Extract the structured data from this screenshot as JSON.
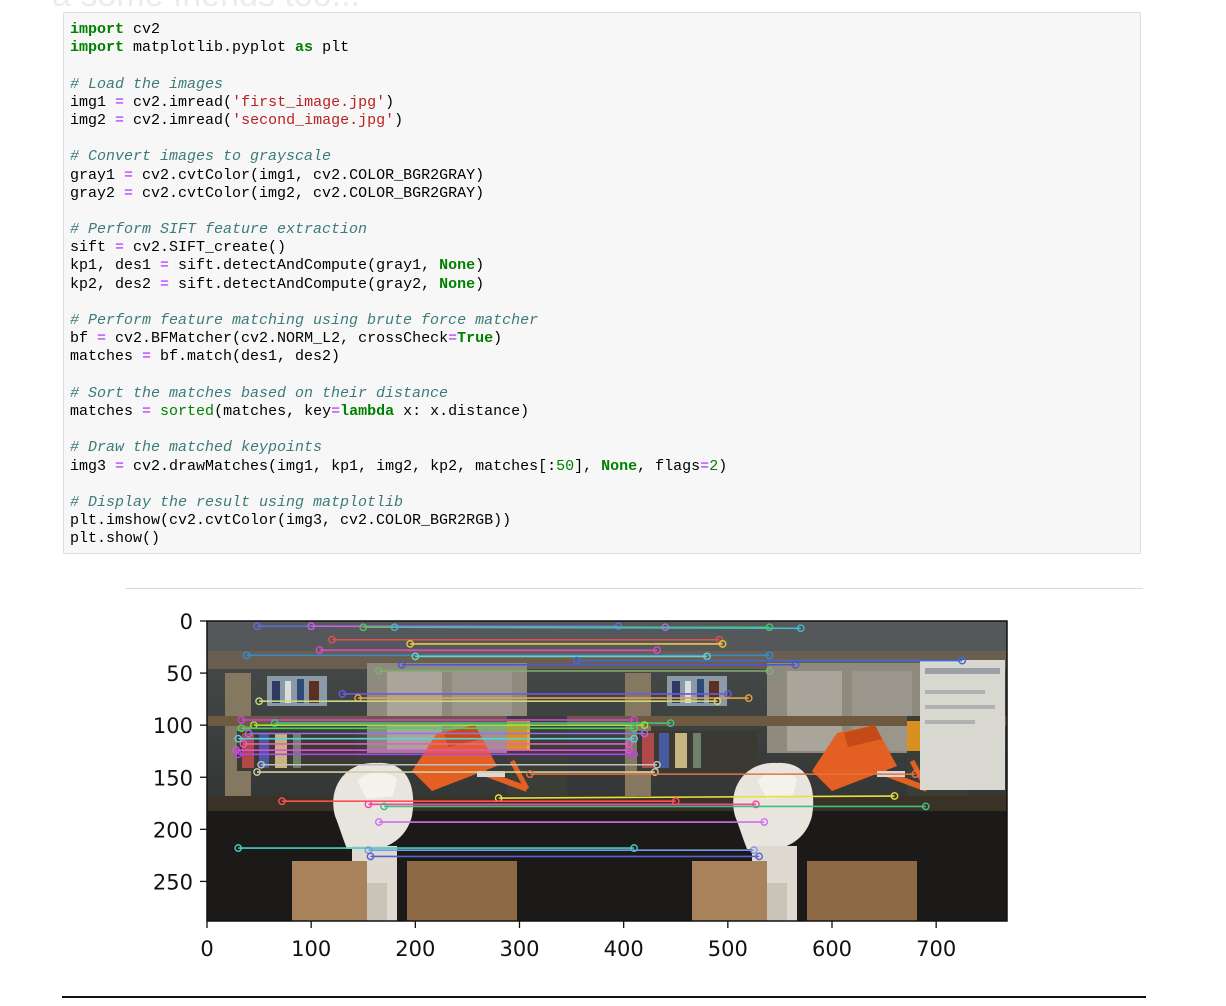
{
  "background_heading": "a some friends too...",
  "code_lines": [
    [
      [
        "kw",
        "import"
      ],
      [
        "t",
        " cv2"
      ]
    ],
    [
      [
        "kw",
        "import"
      ],
      [
        "t",
        " matplotlib.pyplot "
      ],
      [
        "kw",
        "as"
      ],
      [
        "t",
        " plt"
      ]
    ],
    [],
    [
      [
        "cm",
        "# Load the images"
      ]
    ],
    [
      [
        "t",
        "img1 "
      ],
      [
        "op",
        "="
      ],
      [
        "t",
        " cv2.imread("
      ],
      [
        "str",
        "'first_image.jpg'"
      ],
      [
        "t",
        ")"
      ]
    ],
    [
      [
        "t",
        "img2 "
      ],
      [
        "op",
        "="
      ],
      [
        "t",
        " cv2.imread("
      ],
      [
        "str",
        "'second_image.jpg'"
      ],
      [
        "t",
        ")"
      ]
    ],
    [],
    [
      [
        "cm",
        "# Convert images to grayscale"
      ]
    ],
    [
      [
        "t",
        "gray1 "
      ],
      [
        "op",
        "="
      ],
      [
        "t",
        " cv2.cvtColor(img1, cv2.COLOR_BGR2GRAY)"
      ]
    ],
    [
      [
        "t",
        "gray2 "
      ],
      [
        "op",
        "="
      ],
      [
        "t",
        " cv2.cvtColor(img2, cv2.COLOR_BGR2GRAY)"
      ]
    ],
    [],
    [
      [
        "cm",
        "# Perform SIFT feature extraction"
      ]
    ],
    [
      [
        "t",
        "sift "
      ],
      [
        "op",
        "="
      ],
      [
        "t",
        " cv2.SIFT_create()"
      ]
    ],
    [
      [
        "t",
        "kp1, des1 "
      ],
      [
        "op",
        "="
      ],
      [
        "t",
        " sift.detectAndCompute(gray1, "
      ],
      [
        "kw",
        "None"
      ],
      [
        "t",
        ")"
      ]
    ],
    [
      [
        "t",
        "kp2, des2 "
      ],
      [
        "op",
        "="
      ],
      [
        "t",
        " sift.detectAndCompute(gray2, "
      ],
      [
        "kw",
        "None"
      ],
      [
        "t",
        ")"
      ]
    ],
    [],
    [
      [
        "cm",
        "# Perform feature matching using brute force matcher"
      ]
    ],
    [
      [
        "t",
        "bf "
      ],
      [
        "op",
        "="
      ],
      [
        "t",
        " cv2.BFMatcher(cv2.NORM_L2, crossCheck"
      ],
      [
        "op",
        "="
      ],
      [
        "kw",
        "True"
      ],
      [
        "t",
        ")"
      ]
    ],
    [
      [
        "t",
        "matches "
      ],
      [
        "op",
        "="
      ],
      [
        "t",
        " bf.match(des1, des2)"
      ]
    ],
    [],
    [
      [
        "cm",
        "# Sort the matches based on their distance"
      ]
    ],
    [
      [
        "t",
        "matches "
      ],
      [
        "op",
        "="
      ],
      [
        "t",
        " "
      ],
      [
        "bi",
        "sorted"
      ],
      [
        "t",
        "(matches, key"
      ],
      [
        "op",
        "="
      ],
      [
        "kw",
        "lambda"
      ],
      [
        "t",
        " x: x.distance)"
      ]
    ],
    [],
    [
      [
        "cm",
        "# Draw the matched keypoints"
      ]
    ],
    [
      [
        "t",
        "img3 "
      ],
      [
        "op",
        "="
      ],
      [
        "t",
        " cv2.drawMatches(img1, kp1, img2, kp2, matches[:"
      ],
      [
        "num",
        "50"
      ],
      [
        "t",
        "], "
      ],
      [
        "kw",
        "None"
      ],
      [
        "t",
        ", flags"
      ],
      [
        "op",
        "="
      ],
      [
        "num",
        "2"
      ],
      [
        "t",
        ")"
      ]
    ],
    [],
    [
      [
        "cm",
        "# Display the result using matplotlib"
      ]
    ],
    [
      [
        "t",
        "plt.imshow(cv2.cvtColor(img3, cv2.COLOR_BGR2RGB))"
      ]
    ],
    [
      [
        "t",
        "plt.show()"
      ]
    ]
  ],
  "chart_data": {
    "type": "image",
    "xlim": [
      0,
      768
    ],
    "ylim": [
      288,
      0
    ],
    "xticks": [
      0,
      100,
      200,
      300,
      400,
      500,
      600,
      700
    ],
    "yticks": [
      0,
      50,
      100,
      150,
      200,
      250
    ],
    "image_width_per_view": 384,
    "matches": [
      {
        "y1": 5,
        "x1": 48,
        "y2": 5,
        "x2": 395,
        "color": "#5b6fd8"
      },
      {
        "y1": 5,
        "x1": 100,
        "y2": 6,
        "x2": 440,
        "color": "#c860e0"
      },
      {
        "y1": 6,
        "x1": 150,
        "y2": 6,
        "x2": 540,
        "color": "#52c75a"
      },
      {
        "y1": 6,
        "x1": 180,
        "y2": 7,
        "x2": 570,
        "color": "#44b8c8"
      },
      {
        "y1": 18,
        "x1": 120,
        "y2": 18,
        "x2": 492,
        "color": "#e05050"
      },
      {
        "y1": 22,
        "x1": 195,
        "y2": 22,
        "x2": 495,
        "color": "#e8c840"
      },
      {
        "y1": 28,
        "x1": 108,
        "y2": 28,
        "x2": 432,
        "color": "#d84ac0"
      },
      {
        "y1": 33,
        "x1": 38,
        "y2": 33,
        "x2": 540,
        "color": "#2f8fd0"
      },
      {
        "y1": 34,
        "x1": 200,
        "y2": 34,
        "x2": 480,
        "color": "#70d0c0"
      },
      {
        "y1": 38,
        "x1": 355,
        "y2": 38,
        "x2": 725,
        "color": "#3c6be0"
      },
      {
        "y1": 42,
        "x1": 187,
        "y2": 42,
        "x2": 565,
        "color": "#4a58c8"
      },
      {
        "y1": 48,
        "x1": 165,
        "y2": 48,
        "x2": 540,
        "color": "#7fb070"
      },
      {
        "y1": 70,
        "x1": 130,
        "y2": 70,
        "x2": 500,
        "color": "#6b5ae0"
      },
      {
        "y1": 74,
        "x1": 145,
        "y2": 74,
        "x2": 520,
        "color": "#e8a040"
      },
      {
        "y1": 77,
        "x1": 50,
        "y2": 77,
        "x2": 490,
        "color": "#c8d880"
      },
      {
        "y1": 95,
        "x1": 33,
        "y2": 95,
        "x2": 410,
        "color": "#d040d8"
      },
      {
        "y1": 98,
        "x1": 65,
        "y2": 98,
        "x2": 445,
        "color": "#40c080"
      },
      {
        "y1": 100,
        "x1": 45,
        "y2": 100,
        "x2": 420,
        "color": "#a0e040"
      },
      {
        "y1": 103,
        "x1": 33,
        "y2": 103,
        "x2": 410,
        "color": "#4ad060"
      },
      {
        "y1": 108,
        "x1": 40,
        "y2": 108,
        "x2": 420,
        "color": "#9870e8"
      },
      {
        "y1": 113,
        "x1": 30,
        "y2": 113,
        "x2": 410,
        "color": "#5ad0e0"
      },
      {
        "y1": 118,
        "x1": 35,
        "y2": 118,
        "x2": 405,
        "color": "#e060c0"
      },
      {
        "y1": 124,
        "x1": 28,
        "y2": 124,
        "x2": 405,
        "color": "#e050e0"
      },
      {
        "y1": 128,
        "x1": 30,
        "y2": 128,
        "x2": 410,
        "color": "#b840f0"
      },
      {
        "y1": 138,
        "x1": 52,
        "y2": 138,
        "x2": 432,
        "color": "#c0c0c0"
      },
      {
        "y1": 145,
        "x1": 48,
        "y2": 145,
        "x2": 430,
        "color": "#d0d0a0"
      },
      {
        "y1": 147,
        "x1": 310,
        "y2": 147,
        "x2": 680,
        "color": "#e87040"
      },
      {
        "y1": 170,
        "x1": 280,
        "y2": 168,
        "x2": 660,
        "color": "#e8e040"
      },
      {
        "y1": 173,
        "x1": 72,
        "y2": 173,
        "x2": 450,
        "color": "#ff5050"
      },
      {
        "y1": 176,
        "x1": 155,
        "y2": 176,
        "x2": 527,
        "color": "#ff40a0"
      },
      {
        "y1": 178,
        "x1": 170,
        "y2": 178,
        "x2": 690,
        "color": "#40c080"
      },
      {
        "y1": 193,
        "x1": 165,
        "y2": 193,
        "x2": 535,
        "color": "#d070f0"
      },
      {
        "y1": 218,
        "x1": 30,
        "y2": 218,
        "x2": 410,
        "color": "#40d0c0"
      },
      {
        "y1": 220,
        "x1": 155,
        "y2": 220,
        "x2": 525,
        "color": "#7a9ae0"
      },
      {
        "y1": 226,
        "x1": 157,
        "y2": 226,
        "x2": 530,
        "color": "#5a60d0"
      }
    ]
  },
  "colors": {
    "wall": "#2a2f2e",
    "shelf": "#5a4630",
    "lamp": "#e46022",
    "bust": "#e8e4de",
    "box": "#a8825a",
    "table": "#3b3226"
  }
}
